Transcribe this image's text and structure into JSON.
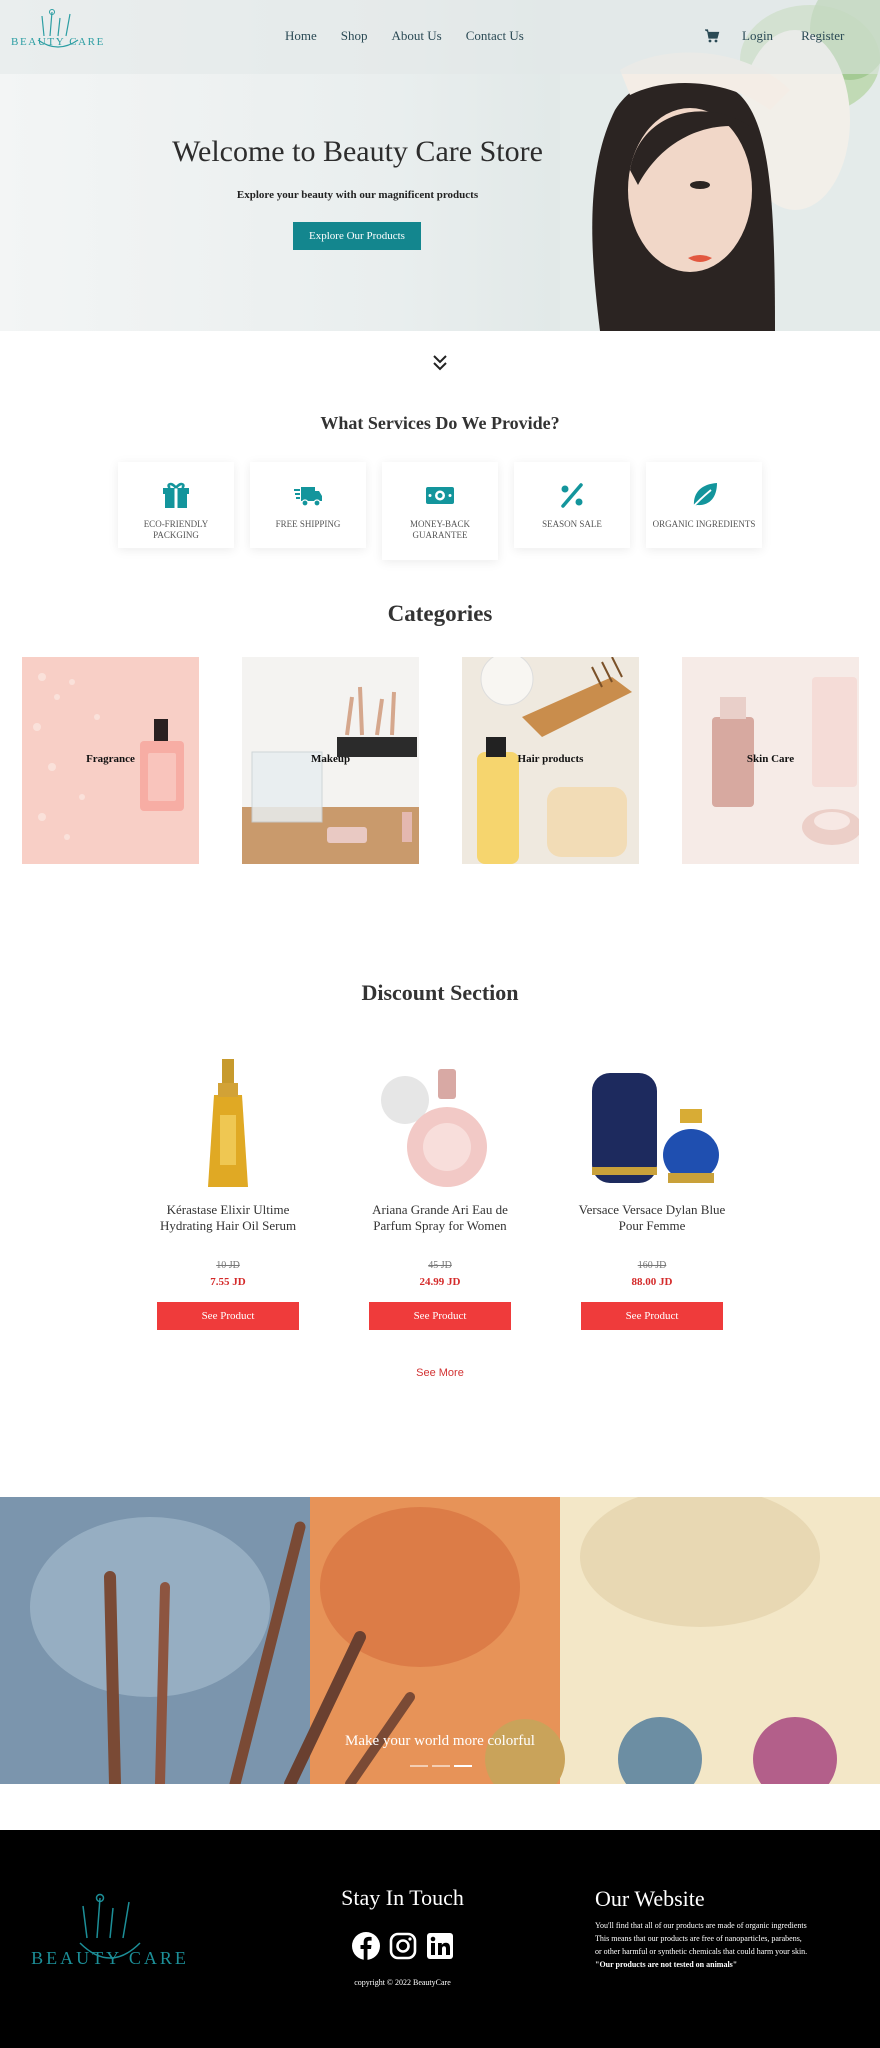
{
  "brand": {
    "name": "BEAUTY CARE",
    "accent": "#13868e"
  },
  "nav": {
    "links": [
      "Home",
      "Shop",
      "About Us",
      "Contact Us"
    ],
    "login": "Login",
    "register": "Register",
    "cart_icon": "cart-icon"
  },
  "hero": {
    "title": "Welcome to Beauty Care Store",
    "subtitle": "Explore your beauty with our magnificent products",
    "button": "Explore Our Products"
  },
  "services": {
    "title": "What Services Do We Provide?",
    "items": [
      {
        "label": "ECO-FRIENDLY PACKGING",
        "icon": "gift-icon"
      },
      {
        "label": "FREE SHIPPING",
        "icon": "truck-icon"
      },
      {
        "label": "MONEY-BACK GUARANTEE",
        "icon": "money-icon"
      },
      {
        "label": "SEASON SALE",
        "icon": "percent-icon"
      },
      {
        "label": "ORGANIC INGREDIENTS",
        "icon": "leaf-icon"
      }
    ]
  },
  "categories": {
    "title": "Categories",
    "items": [
      "Fragrance",
      "Makeup",
      "Hair products",
      "Skin Care"
    ]
  },
  "discount": {
    "title": "Discount Section",
    "products": [
      {
        "name": "Kérastase Elixir Ultime Hydrating Hair Oil Serum",
        "old_price": "10 JD",
        "new_price": "7.55 JD",
        "button": "See Product"
      },
      {
        "name": "Ariana Grande Ari Eau de Parfum Spray for Women",
        "old_price": "45 JD",
        "new_price": "24.99 JD",
        "button": "See Product"
      },
      {
        "name": "Versace Versace Dylan Blue Pour Femme",
        "old_price": "160 JD",
        "new_price": "88.00 JD",
        "button": "See Product"
      }
    ],
    "see_more": "See More"
  },
  "banner": {
    "caption": "Make your world more colorful"
  },
  "footer": {
    "logo": "BEAUTY CARE",
    "stay_title": "Stay In Touch",
    "social": [
      "facebook-icon",
      "instagram-icon",
      "linkedin-icon"
    ],
    "copyright": "copyright © 2022 BeautyCare",
    "site_title": "Our Website",
    "site_text": "You'll find that all of our products are made of organic ingredients This means that our products are free of nanoparticles, parabens, or other harmful or synthetic chemicals that could harm your skin.",
    "site_text_bold": "\"Our products are not tested on animals\""
  }
}
